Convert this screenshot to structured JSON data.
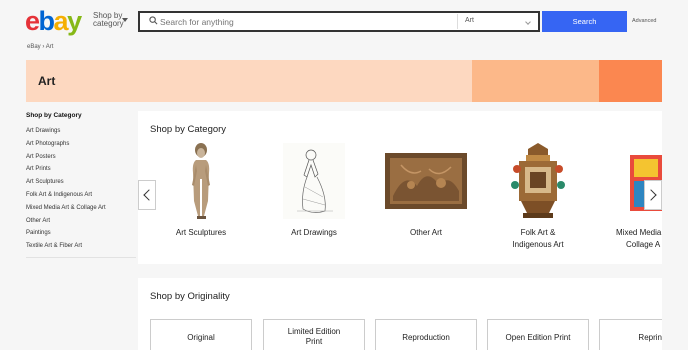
{
  "header": {
    "logo": {
      "e": "e",
      "b": "b",
      "a": "a",
      "y": "y"
    },
    "shop_by_line1": "Shop by",
    "shop_by_line2": "category",
    "search_placeholder": "Search for anything",
    "search_category": "Art",
    "search_button": "Search",
    "advanced_link": "Advanced"
  },
  "breadcrumb": {
    "home": "eBay",
    "separator": "›",
    "current": "Art"
  },
  "banner": {
    "title": "Art"
  },
  "sidebar": {
    "title": "Shop by Category",
    "items": [
      "Art Drawings",
      "Art Photographs",
      "Art Posters",
      "Art Prints",
      "Art Sculptures",
      "Folk Art & Indigenous Art",
      "Mixed Media Art & Collage Art",
      "Other Art",
      "Paintings",
      "Textile Art & Fiber Art"
    ]
  },
  "shop_by_category": {
    "heading": "Shop by Category",
    "tiles": [
      {
        "line1": "Art Sculptures",
        "line2": ""
      },
      {
        "line1": "Art Drawings",
        "line2": ""
      },
      {
        "line1": "Other Art",
        "line2": ""
      },
      {
        "line1": "Folk Art &",
        "line2": "Indigenous Art"
      },
      {
        "line1": "Mixed Media",
        "line2": "Collage A"
      }
    ]
  },
  "shop_by_originality": {
    "heading": "Shop by Originality",
    "buttons": [
      {
        "line1": "Original",
        "line2": ""
      },
      {
        "line1": "Limited Edition",
        "line2": "Print"
      },
      {
        "line1": "Reproduction",
        "line2": ""
      },
      {
        "line1": "Open Edition Print",
        "line2": ""
      },
      {
        "line1": "Reprin",
        "line2": ""
      }
    ]
  },
  "icons": {
    "search": "search-icon",
    "prev": "chevron-left-icon",
    "next": "chevron-right-icon"
  },
  "colors": {
    "search_button": "#3665f3",
    "banner": "#fdd8c0",
    "banner_mid": "#fcb889",
    "banner_end": "#fb8750"
  }
}
